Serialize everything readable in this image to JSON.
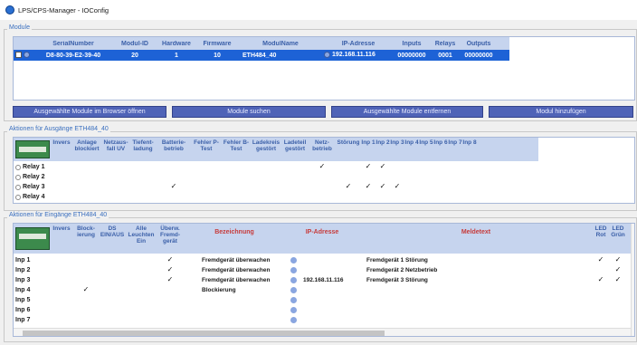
{
  "window": {
    "title": "LPS/CPS-Manager - IOConfig"
  },
  "modules": {
    "group_title": "Module",
    "columns": [
      "SerialNumber",
      "Modul-ID",
      "Hardware",
      "Firmware",
      "ModulName",
      "IP-Adresse",
      "Inputs",
      "Relays",
      "Outputs"
    ],
    "row": {
      "serial": "D8-80-39-E2-39-40",
      "modul_id": "20",
      "hardware": "1",
      "firmware": "10",
      "name": "ETH484_40",
      "ip": "192.168.11.116",
      "inputs": "00000000",
      "relays": "0001",
      "outputs": "00000000"
    }
  },
  "buttons": {
    "open_browser": "Ausgewählte Module im Browser öffnen",
    "search": "Module suchen",
    "remove": "Ausgewählte Module entfernen",
    "add": "Modul hinzufügen"
  },
  "outputs": {
    "group_title": "Aktionen für Ausgänge ETH484_40",
    "columns": [
      "Invers",
      "Anlage blockiert",
      "Netzaus-fall UV",
      "Tiefent-ladung",
      "Batterie-betrieb",
      "Fehler P-Test",
      "Fehler B-Test",
      "Ladekreis gestört",
      "Ladeteil gestört",
      "Netz-betrieb",
      "Störung",
      "Inp 1",
      "Inp 2",
      "Inp 3",
      "Inp 4",
      "Inp 5",
      "Inp 6",
      "Inp 7",
      "Inp 8"
    ],
    "rows": [
      "Relay 1",
      "Relay 2",
      "Relay 3",
      "Relay 4"
    ],
    "check_mark": "✓"
  },
  "inputs": {
    "group_title": "Aktionen für Eingänge ETH484_40",
    "columns": [
      "Invers",
      "Block-ierung",
      "DS EIN/AUS",
      "Alle Leuchten Ein",
      "Überw. Fremd-gerät",
      "Bezeichnung",
      "IP-Adresse",
      "Meldetext",
      "LED Rot",
      "LED Grün"
    ],
    "rows": [
      {
        "label": "Inp 1",
        "bez": "Fremdgerät überwachen",
        "ip": "",
        "text": "Fremdgerät 1 Störung"
      },
      {
        "label": "Inp 2",
        "bez": "Fremdgerät überwachen",
        "ip": "",
        "text": "Fremdgerät 2 Netzbetrieb"
      },
      {
        "label": "Inp 3",
        "bez": "Fremdgerät überwachen",
        "ip": "192.168.11.116",
        "text": "Fremdgerät 3 Störung"
      },
      {
        "label": "Inp 4",
        "bez": "Blockierung",
        "ip": "",
        "text": ""
      },
      {
        "label": "Inp 5",
        "bez": "",
        "ip": "",
        "text": ""
      },
      {
        "label": "Inp 6",
        "bez": "",
        "ip": "",
        "text": ""
      },
      {
        "label": "Inp 7",
        "bez": "",
        "ip": "",
        "text": ""
      }
    ]
  }
}
